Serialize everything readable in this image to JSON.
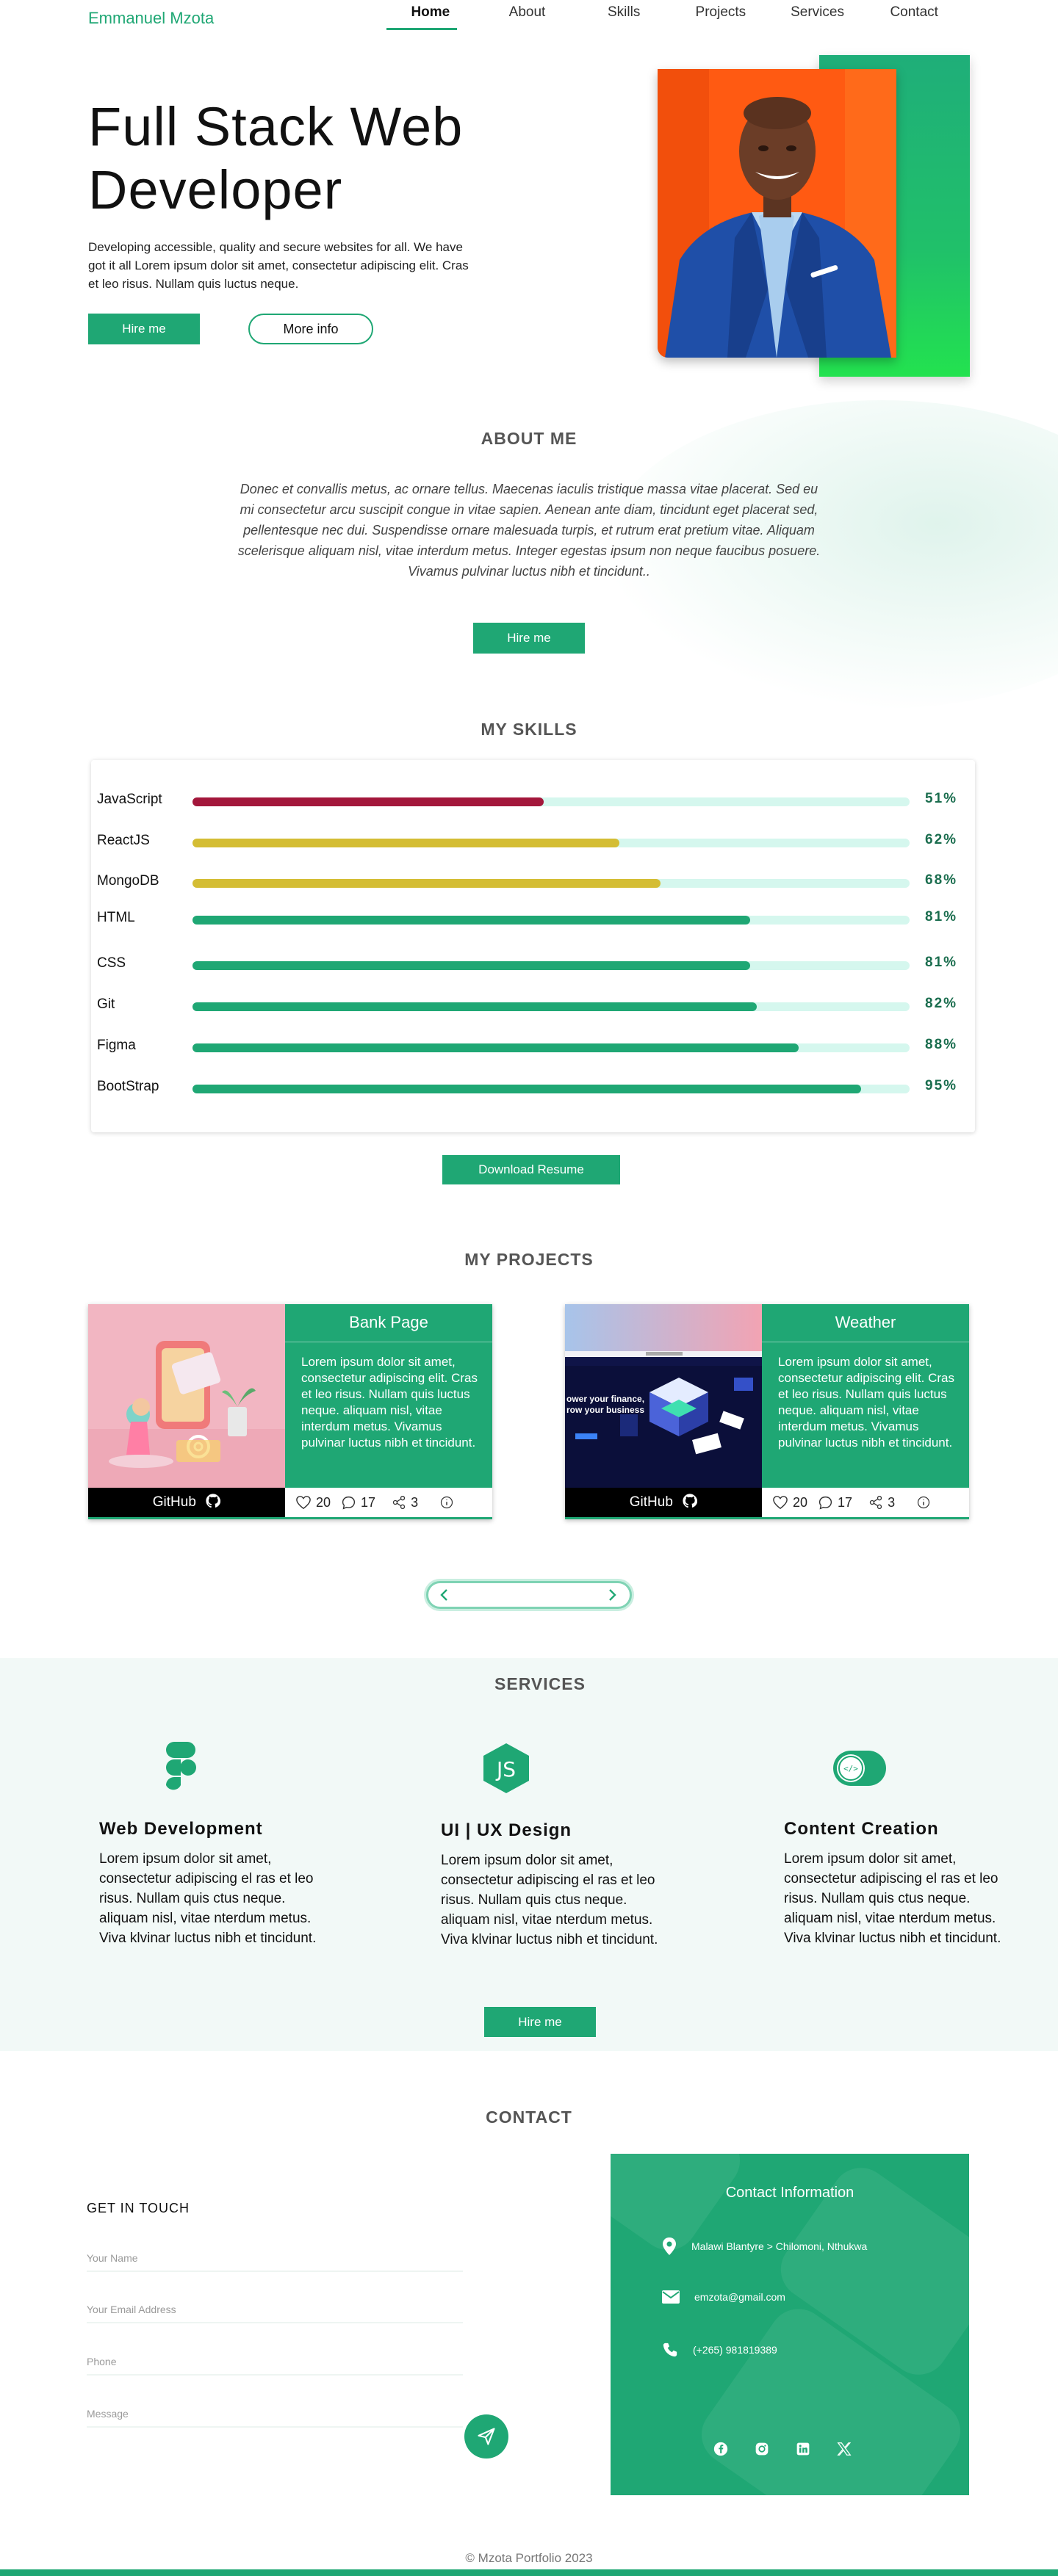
{
  "brand": "Emmanuel Mzota",
  "nav": {
    "items": [
      "Home",
      "About",
      "Skills",
      "Projects",
      "Services",
      "Contact"
    ],
    "active": "Home"
  },
  "hero": {
    "title_line1": "Full Stack Web",
    "title_line2": "Developer",
    "description": "Developing accessible, quality and secure websites for all. We have got it all Lorem ipsum dolor sit amet, consectetur adipiscing elit. Cras et leo risus. Nullam quis luctus neque.",
    "hire_label": "Hire me",
    "more_label": "More info"
  },
  "about": {
    "title": "ABOUT ME",
    "text": "Donec et convallis metus, ac ornare tellus. Maecenas iaculis tristique massa vitae placerat. Sed eu mi consectetur arcu suscipit congue in vitae sapien. Aenean ante diam, tincidunt eget placerat sed, pellentesque nec dui. Suspendisse ornare malesuada turpis, et rutrum erat pretium vitae. Aliquam scelerisque aliquam nisl, vitae interdum metus. Integer egestas ipsum non neque faucibus posuere. Vivamus pulvinar luctus nibh et tincidunt..",
    "hire_label": "Hire me"
  },
  "skills": {
    "title": "MY SKILLS",
    "items": [
      {
        "name": "JavaScript",
        "value": 51,
        "pct": "51%",
        "color": "#a3173b"
      },
      {
        "name": "ReactJS",
        "value": 62,
        "pct": "62%",
        "color": "#d4bd34"
      },
      {
        "name": "MongoDB",
        "value": 68,
        "pct": "68%",
        "color": "#d4bd34"
      },
      {
        "name": "HTML",
        "value": 81,
        "pct": "81%",
        "color": "#1fa774"
      },
      {
        "name": "CSS",
        "value": 81,
        "pct": "81%",
        "color": "#1fa774"
      },
      {
        "name": "Git",
        "value": 82,
        "pct": "82%",
        "color": "#1fa774"
      },
      {
        "name": "Figma",
        "value": 88,
        "pct": "88%",
        "color": "#1fa774"
      },
      {
        "name": "BootStrap",
        "value": 95,
        "pct": "95%",
        "color": "#1fa774"
      }
    ],
    "download_label": "Download Resume"
  },
  "projects": {
    "title": "MY PROJECTS",
    "items": [
      {
        "title": "Bank Page",
        "description": "Lorem ipsum dolor sit amet, consectetur adipiscing elit. Cras et leo risus. Nullam quis luctus neque. aliquam nisl, vitae interdum metus. Vivamus pulvinar luctus nibh et tincidunt.",
        "github_label": "GitHub",
        "likes": "20",
        "comments": "17",
        "shares": "3"
      },
      {
        "title": "Weather",
        "description": "Lorem ipsum dolor sit amet, consectetur adipiscing elit. Cras et leo risus. Nullam quis luctus neque. aliquam nisl, vitae interdum metus. Vivamus pulvinar luctus nibh et tincidunt.",
        "github_label": "GitHub",
        "likes": "20",
        "comments": "17",
        "shares": "3",
        "screenshot_text_1": "ower your finance,",
        "screenshot_text_2": "row your business"
      }
    ]
  },
  "services": {
    "title": "SERVICES",
    "items": [
      {
        "title": "Web Development",
        "icon": "figma-icon",
        "description": "Lorem ipsum dolor sit amet, consectetur adipiscing el  ras et leo risus. Nullam quis ctus neque. aliquam nisl, vitae nterdum metus.  Viva klvinar luctus nibh et tincidunt."
      },
      {
        "title": "UI | UX Design",
        "icon": "js-icon",
        "description": "Lorem ipsum dolor sit amet, consectetur adipiscing el  ras et leo risus. Nullam quis ctus neque. aliquam nisl, vitae nterdum metus.  Viva klvinar luctus nibh et tincidunt."
      },
      {
        "title": "Content Creation",
        "icon": "code-toggle-icon",
        "description": "Lorem ipsum dolor sit amet, consectetur adipiscing el  ras et leo risus. Nullam quis ctus neque. aliquam nisl, vitae nterdum metus.  Viva klvinar luctus nibh et tincidunt."
      }
    ],
    "hire_label": "Hire me"
  },
  "contact": {
    "title": "CONTACT",
    "get_in_touch": "GET IN TOUCH",
    "placeholders": {
      "name": "Your Name",
      "email": "Your Email Address",
      "phone": "Phone",
      "message": "Message"
    },
    "info_title": "Contact Information",
    "address": "Malawi Blantyre > Chilomoni, Nthukwa",
    "email": "emzota@gmail.com",
    "phone": "(+265) 981819389",
    "socials": [
      "facebook-icon",
      "instagram-icon",
      "linkedin-icon",
      "x-icon"
    ]
  },
  "footer": {
    "text": "© Mzota Portfolio 2023"
  },
  "colors": {
    "accent": "#1fa774",
    "accent_bright": "#23e24f",
    "hero_photo_bg": "#ff5a12",
    "suit": "#1f4fa8"
  }
}
